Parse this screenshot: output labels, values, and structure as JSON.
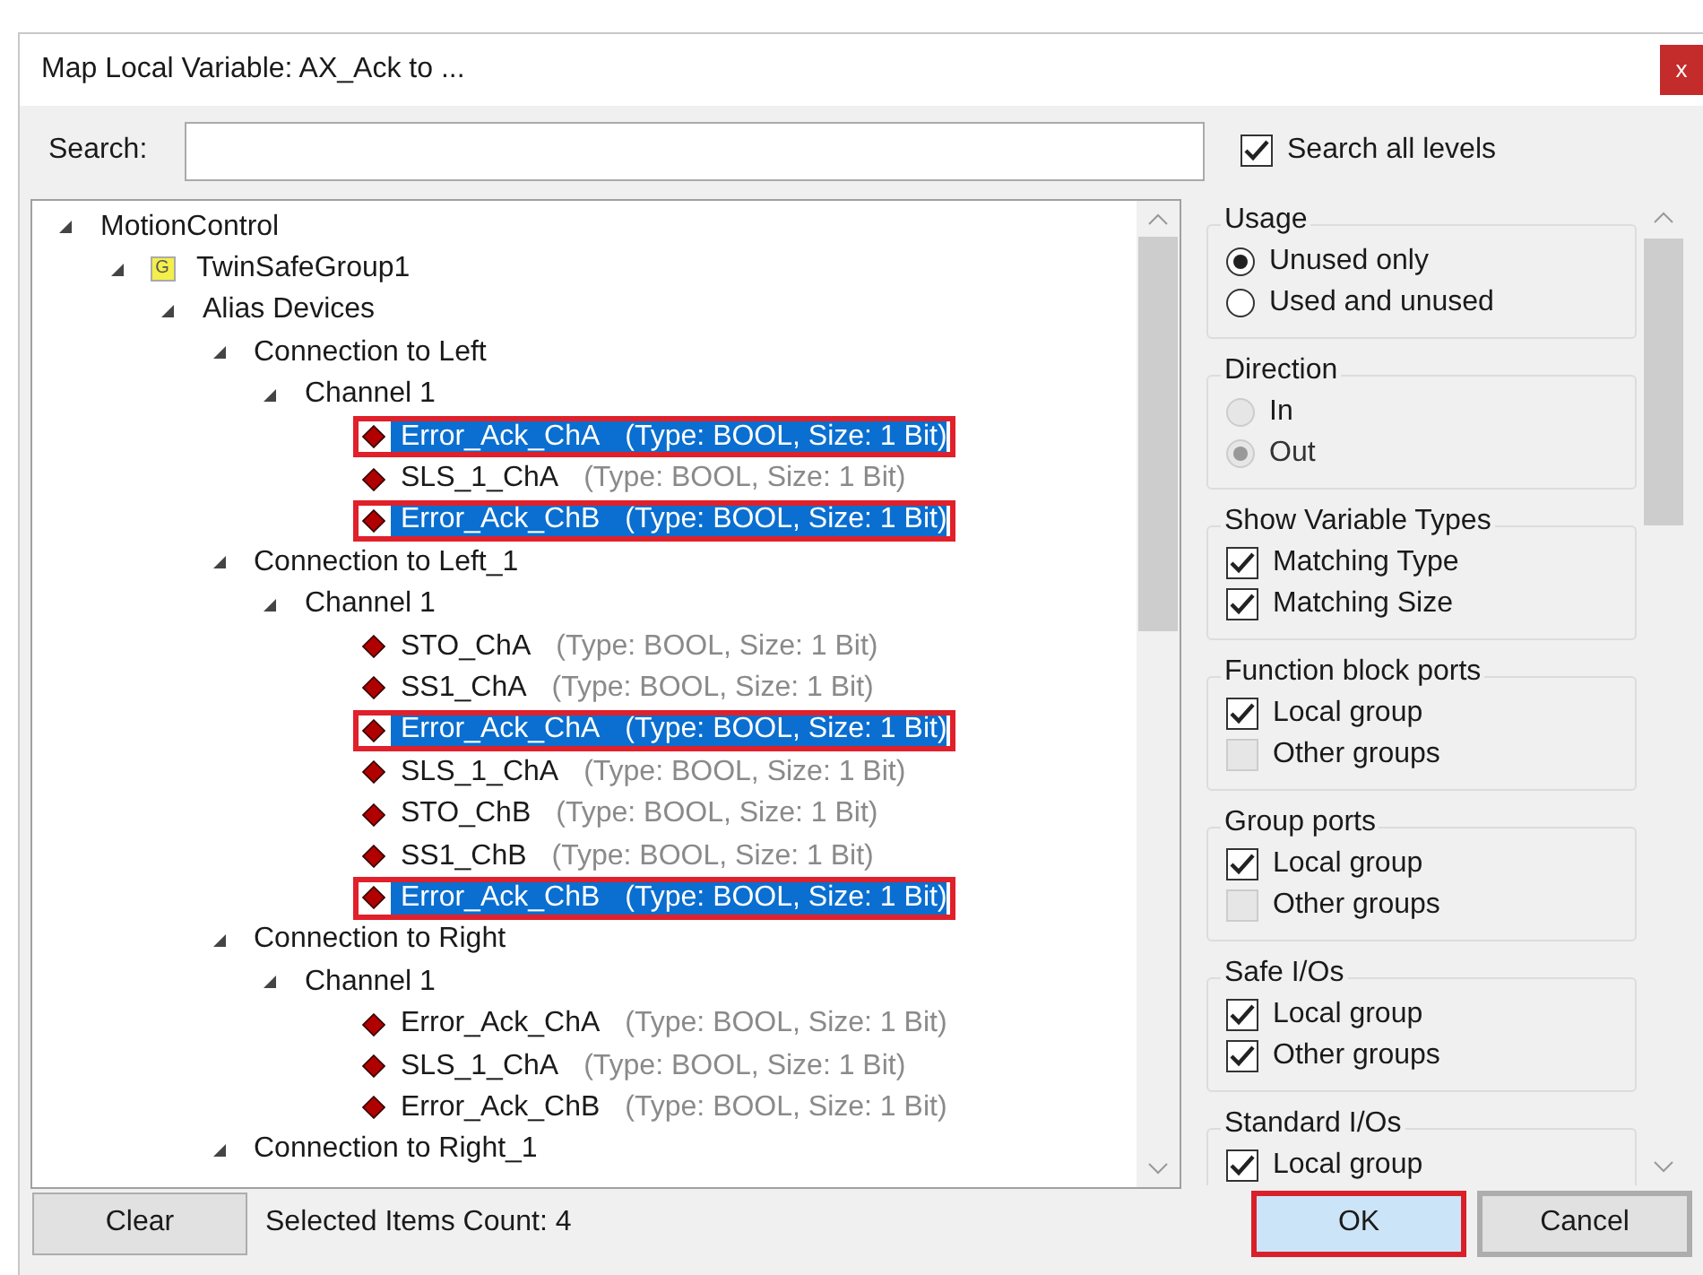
{
  "window": {
    "title": "Map Local Variable: AX_Ack to ...",
    "close": "x"
  },
  "search": {
    "label": "Search:",
    "all_levels": {
      "label": "Search all levels",
      "checked": true
    }
  },
  "tree": [
    {
      "label": "MotionControl",
      "kind": "folder",
      "expanded": true,
      "children": [
        {
          "label": "TwinSafeGroup1",
          "kind": "group",
          "badge": "G",
          "expanded": true,
          "children": [
            {
              "label": "Alias Devices",
              "kind": "folder",
              "expanded": true,
              "children": [
                {
                  "label": "Connection to Left",
                  "kind": "folder",
                  "expanded": true,
                  "children": [
                    {
                      "label": "Channel 1",
                      "kind": "folder",
                      "expanded": true,
                      "children": [
                        {
                          "label": "Error_Ack_ChA",
                          "type_info": "(Type: BOOL, Size: 1 Bit)",
                          "kind": "variable",
                          "selected": true,
                          "outlined": true
                        },
                        {
                          "label": "SLS_1_ChA",
                          "type_info": "(Type: BOOL, Size: 1 Bit)",
                          "kind": "variable",
                          "selected": false,
                          "outlined": false
                        },
                        {
                          "label": "Error_Ack_ChB",
                          "type_info": "(Type: BOOL, Size: 1 Bit)",
                          "kind": "variable",
                          "selected": true,
                          "outlined": true
                        }
                      ]
                    }
                  ]
                },
                {
                  "label": "Connection to Left_1",
                  "kind": "folder",
                  "expanded": true,
                  "children": [
                    {
                      "label": "Channel 1",
                      "kind": "folder",
                      "expanded": true,
                      "children": [
                        {
                          "label": "STO_ChA",
                          "type_info": "(Type: BOOL, Size: 1 Bit)",
                          "kind": "variable",
                          "selected": false,
                          "outlined": false
                        },
                        {
                          "label": "SS1_ChA",
                          "type_info": "(Type: BOOL, Size: 1 Bit)",
                          "kind": "variable",
                          "selected": false,
                          "outlined": false
                        },
                        {
                          "label": "Error_Ack_ChA",
                          "type_info": "(Type: BOOL, Size: 1 Bit)",
                          "kind": "variable",
                          "selected": true,
                          "outlined": true
                        },
                        {
                          "label": "SLS_1_ChA",
                          "type_info": "(Type: BOOL, Size: 1 Bit)",
                          "kind": "variable",
                          "selected": false,
                          "outlined": false
                        },
                        {
                          "label": "STO_ChB",
                          "type_info": "(Type: BOOL, Size: 1 Bit)",
                          "kind": "variable",
                          "selected": false,
                          "outlined": false
                        },
                        {
                          "label": "SS1_ChB",
                          "type_info": "(Type: BOOL, Size: 1 Bit)",
                          "kind": "variable",
                          "selected": false,
                          "outlined": false
                        },
                        {
                          "label": "Error_Ack_ChB",
                          "type_info": "(Type: BOOL, Size: 1 Bit)",
                          "kind": "variable",
                          "selected": true,
                          "outlined": true
                        }
                      ]
                    }
                  ]
                },
                {
                  "label": "Connection to Right",
                  "kind": "folder",
                  "expanded": true,
                  "children": [
                    {
                      "label": "Channel 1",
                      "kind": "folder",
                      "expanded": true,
                      "children": [
                        {
                          "label": "Error_Ack_ChA",
                          "type_info": "(Type: BOOL, Size: 1 Bit)",
                          "kind": "variable",
                          "selected": false,
                          "outlined": false
                        },
                        {
                          "label": "SLS_1_ChA",
                          "type_info": "(Type: BOOL, Size: 1 Bit)",
                          "kind": "variable",
                          "selected": false,
                          "outlined": false
                        },
                        {
                          "label": "Error_Ack_ChB",
                          "type_info": "(Type: BOOL, Size: 1 Bit)",
                          "kind": "variable",
                          "selected": false,
                          "outlined": false
                        }
                      ]
                    }
                  ]
                },
                {
                  "label": "Connection to Right_1",
                  "kind": "folder",
                  "expanded": true
                }
              ]
            }
          ]
        }
      ]
    }
  ],
  "filters": [
    {
      "title": "Usage",
      "options": [
        {
          "label": "Unused only",
          "kind": "radio",
          "checked": true,
          "disabled": false
        },
        {
          "label": "Used and unused",
          "kind": "radio",
          "checked": false,
          "disabled": false
        }
      ]
    },
    {
      "title": "Direction",
      "options": [
        {
          "label": "In",
          "kind": "radio",
          "checked": false,
          "disabled": true
        },
        {
          "label": "Out",
          "kind": "radio",
          "checked": true,
          "disabled": true
        }
      ]
    },
    {
      "title": "Show Variable Types",
      "options": [
        {
          "label": "Matching Type",
          "kind": "checkbox",
          "checked": true,
          "disabled": false
        },
        {
          "label": "Matching Size",
          "kind": "checkbox",
          "checked": true,
          "disabled": false
        }
      ]
    },
    {
      "title": "Function block ports",
      "options": [
        {
          "label": "Local group",
          "kind": "checkbox",
          "checked": true,
          "disabled": false
        },
        {
          "label": "Other groups",
          "kind": "checkbox",
          "checked": false,
          "disabled": true
        }
      ]
    },
    {
      "title": "Group ports",
      "options": [
        {
          "label": "Local group",
          "kind": "checkbox",
          "checked": true,
          "disabled": false
        },
        {
          "label": "Other groups",
          "kind": "checkbox",
          "checked": false,
          "disabled": true
        }
      ]
    },
    {
      "title": "Safe I/Os",
      "options": [
        {
          "label": "Local group",
          "kind": "checkbox",
          "checked": true,
          "disabled": false
        },
        {
          "label": "Other groups",
          "kind": "checkbox",
          "checked": true,
          "disabled": false
        }
      ]
    },
    {
      "title": "Standard I/Os",
      "options": [
        {
          "label": "Local group",
          "kind": "checkbox",
          "checked": true,
          "disabled": false
        }
      ]
    }
  ],
  "footer": {
    "clear": "Clear",
    "count": "Selected Items Count: 4",
    "buttons": [
      {
        "label": "OK",
        "outlined": true,
        "default": true
      },
      {
        "label": "Cancel",
        "outlined": false,
        "default": false
      }
    ]
  }
}
